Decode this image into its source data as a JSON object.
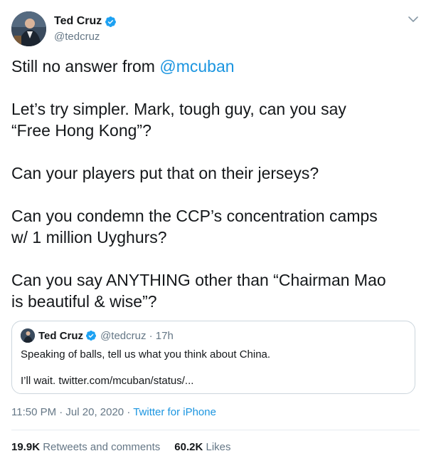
{
  "author": {
    "display_name": "Ted Cruz",
    "handle": "@tedcruz",
    "avatar_icon": "profile-photo",
    "verified_icon": "verified-badge-icon"
  },
  "menu_icon": "chevron-down-icon",
  "tweet": {
    "line1_prefix": "Still no answer from ",
    "line1_mention": "@mcuban",
    "para2_line1": "Let’s try simpler. Mark, tough guy, can you say",
    "para2_line2": "“Free Hong Kong”?",
    "para3": "Can your players put that on their jerseys?",
    "para4_line1": "Can you condemn the CCP’s concentration camps",
    "para4_line2": "w/ 1 million Uyghurs?",
    "para5_line1": "Can you say ANYTHING other than “Chairman Mao",
    "para5_line2": "is beautiful & wise”?"
  },
  "quoted": {
    "display_name": "Ted Cruz",
    "handle_time": "@tedcruz · 17h",
    "line1": "Speaking of balls, tell us what you think about China.",
    "line2": "I’ll wait. twitter.com/mcuban/status/..."
  },
  "meta": {
    "timestamp": "11:50 PM · Jul 20, 2020 · ",
    "source": "Twitter for iPhone"
  },
  "stats": {
    "retweets_count": "19.9K",
    "retweets_label": " Retweets and comments",
    "likes_count": "60.2K",
    "likes_label": " Likes"
  },
  "colors": {
    "link": "#1b95e0",
    "secondary": "#657786",
    "border": "#ccd6dd"
  }
}
